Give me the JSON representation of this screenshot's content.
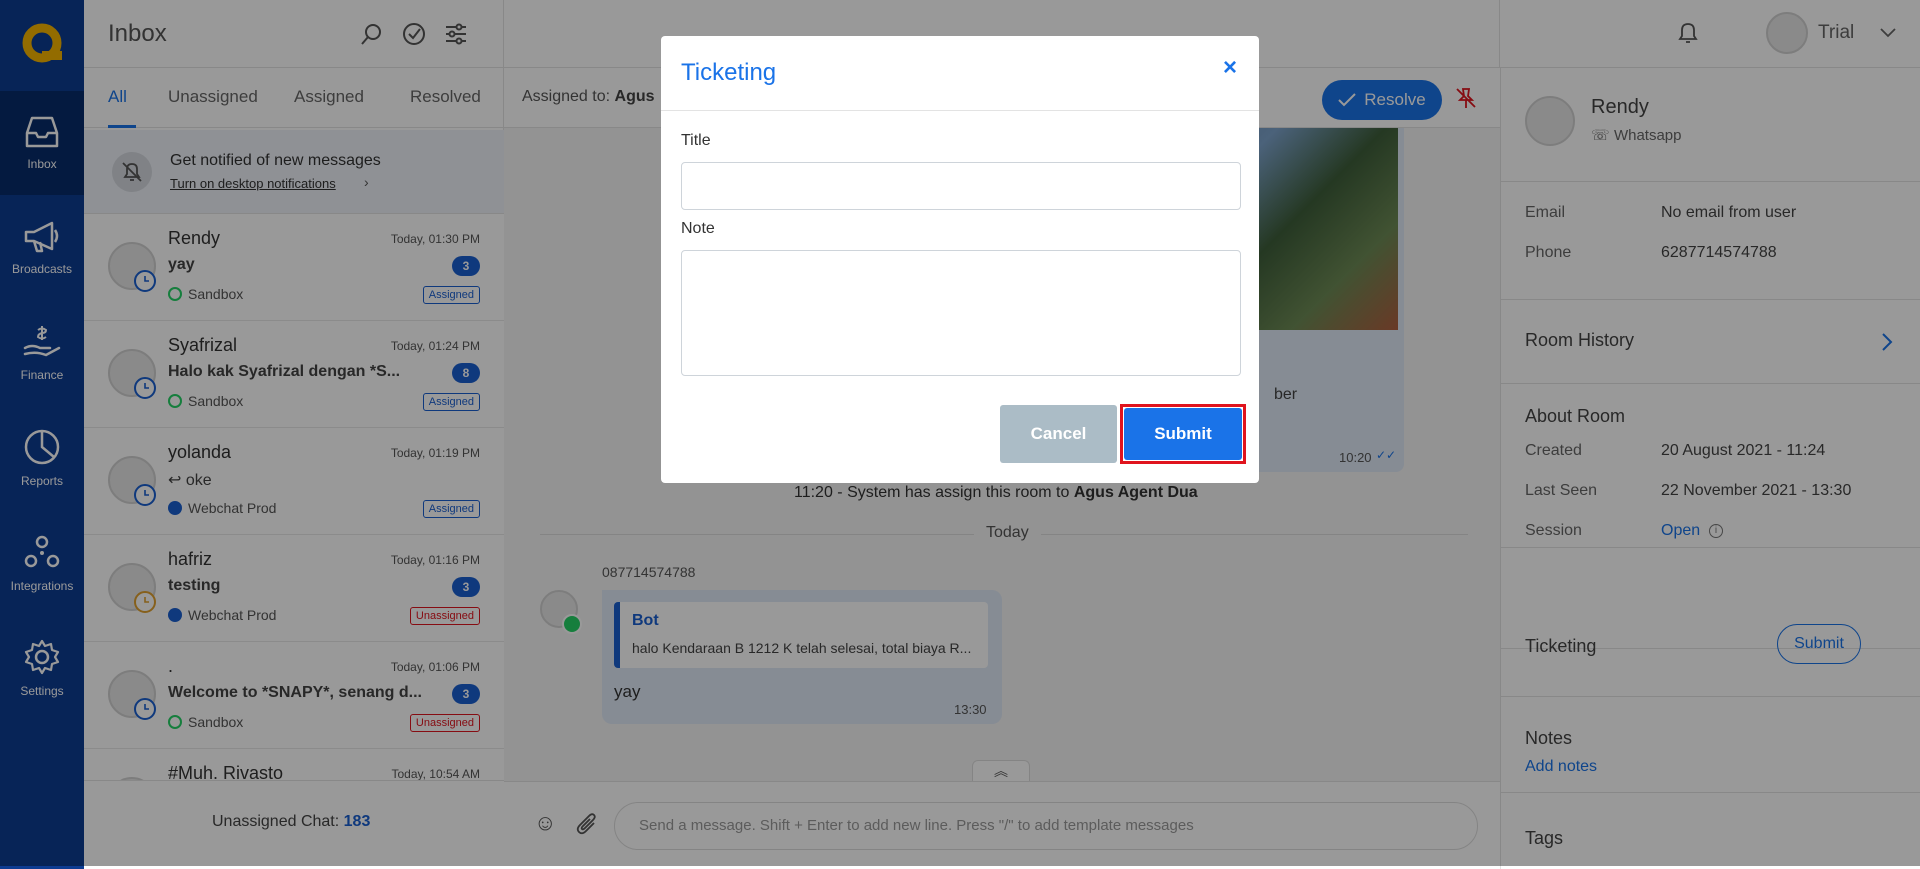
{
  "nav": {
    "items": [
      {
        "label": "Inbox",
        "icon": "inbox-icon"
      },
      {
        "label": "Broadcasts",
        "icon": "megaphone-icon"
      },
      {
        "label": "Finance",
        "icon": "finance-icon"
      },
      {
        "label": "Reports",
        "icon": "pie-chart-icon"
      },
      {
        "label": "Integrations",
        "icon": "integrations-icon"
      },
      {
        "label": "Settings",
        "icon": "gear-icon"
      }
    ]
  },
  "inbox": {
    "title": "Inbox",
    "tabs": [
      "All",
      "Unassigned",
      "Assigned",
      "Resolved"
    ],
    "active_tab": "All",
    "notification": {
      "title": "Get notified of new messages",
      "link": "Turn on desktop notifications"
    },
    "rooms": [
      {
        "name": "Rendy",
        "time": "Today, 01:30 PM",
        "message": "yay",
        "count": "3",
        "channel": "Sandbox",
        "channel_type": "whatsapp",
        "status": "Assigned",
        "clock_color": "#1a5fd0"
      },
      {
        "name": "Syafrizal",
        "time": "Today, 01:24 PM",
        "message": "Halo kak Syafrizal dengan *S...",
        "count": "8",
        "channel": "Sandbox",
        "channel_type": "whatsapp",
        "status": "Assigned",
        "clock_color": "#1a5fd0"
      },
      {
        "name": "yolanda",
        "time": "Today, 01:19 PM",
        "message": "oke",
        "count": "",
        "channel": "Webchat Prod",
        "channel_type": "webchat",
        "status": "Assigned",
        "clock_color": "#1a5fd0"
      },
      {
        "name": "hafriz",
        "time": "Today, 01:16 PM",
        "message": "testing",
        "count": "3",
        "channel": "Webchat Prod",
        "channel_type": "webchat",
        "status": "Unassigned",
        "clock_color": "#e0a030"
      },
      {
        "name": ".",
        "time": "Today, 01:06 PM",
        "message": "Welcome to *SNAPY*, senang d...",
        "count": "3",
        "channel": "Sandbox",
        "channel_type": "whatsapp",
        "status": "Unassigned",
        "clock_color": "#1a5fd0"
      },
      {
        "name": "#Muh. Rivasto",
        "time": "Today, 10:54 AM",
        "message": "",
        "count": "",
        "channel": "",
        "channel_type": "",
        "status": "",
        "clock_color": "#1a5fd0"
      }
    ],
    "footer": {
      "label": "Unassigned Chat:",
      "count": "183"
    }
  },
  "chat": {
    "assigned_label": "Assigned to:",
    "assigned_name": "Agus",
    "resolve_label": "Resolve",
    "partial_text": "ber",
    "image_time": "10:20",
    "system_time": "11:20 - System has assign this room to",
    "system_agent": "Agus Agent Dua",
    "date_divider": "Today",
    "sender_phone": "087714574788",
    "quote_author": "Bot",
    "quote_text": "halo Kendaraan B 1212 K telah selesai, total biaya R...",
    "message_text": "yay",
    "message_time": "13:30",
    "input_placeholder": "Send a message. Shift + Enter to add new line. Press \"/\" to add template messages"
  },
  "header": {
    "user_name": "Trial"
  },
  "contact": {
    "name": "Rendy",
    "channel": "Whatsapp",
    "email_label": "Email",
    "email_value": "No email from user",
    "phone_label": "Phone",
    "phone_value": "6287714574788",
    "room_history": "Room History",
    "about_room": "About Room",
    "created_label": "Created",
    "created_value": "20 August 2021 - 11:24",
    "last_seen_label": "Last Seen",
    "last_seen_value": "22 November 2021 - 13:30",
    "session_label": "Session",
    "session_value": "Open",
    "ticketing_label": "Ticketing",
    "ticketing_button": "Submit",
    "notes_label": "Notes",
    "add_notes": "Add notes",
    "tags_label": "Tags"
  },
  "modal": {
    "title": "Ticketing",
    "title_label": "Title",
    "title_value": "",
    "note_label": "Note",
    "note_value": "",
    "cancel": "Cancel",
    "submit": "Submit"
  },
  "colors": {
    "nav": "#0d3c92",
    "accent": "#1a73e8",
    "logo": "#f5b400",
    "submit": "#1a73e8",
    "submit_outline": "#e0141e"
  }
}
